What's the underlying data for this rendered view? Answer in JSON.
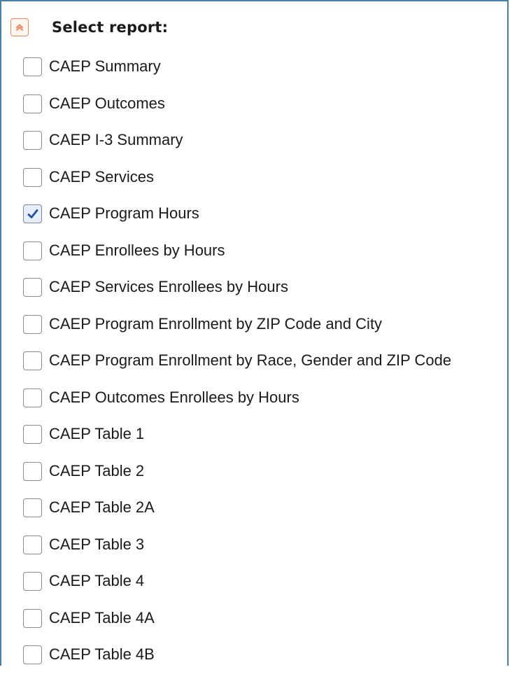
{
  "header": {
    "title": "Select report:",
    "collapse_icon": "chevron-up-icon",
    "accent_color": "#e98a5e"
  },
  "reports": [
    {
      "label": "CAEP Summary",
      "checked": false
    },
    {
      "label": "CAEP Outcomes",
      "checked": false
    },
    {
      "label": "CAEP I-3 Summary",
      "checked": false
    },
    {
      "label": "CAEP Services",
      "checked": false
    },
    {
      "label": "CAEP Program Hours",
      "checked": true
    },
    {
      "label": "CAEP Enrollees by Hours",
      "checked": false
    },
    {
      "label": "CAEP Services Enrollees by Hours",
      "checked": false
    },
    {
      "label": "CAEP Program Enrollment by ZIP Code and City",
      "checked": false
    },
    {
      "label": "CAEP Program Enrollment by Race, Gender and ZIP Code",
      "checked": false
    },
    {
      "label": "CAEP Outcomes Enrollees by Hours",
      "checked": false
    },
    {
      "label": "CAEP Table 1",
      "checked": false
    },
    {
      "label": "CAEP Table 2",
      "checked": false
    },
    {
      "label": "CAEP Table 2A",
      "checked": false
    },
    {
      "label": "CAEP Table 3",
      "checked": false
    },
    {
      "label": "CAEP Table 4",
      "checked": false
    },
    {
      "label": "CAEP Table 4A",
      "checked": false
    },
    {
      "label": "CAEP Table 4B",
      "checked": false
    }
  ],
  "checkmark_color": "#1f4fa3"
}
